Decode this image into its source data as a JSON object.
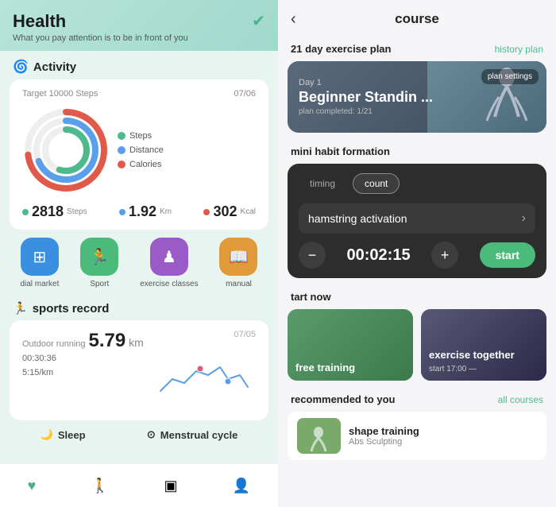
{
  "left": {
    "header": {
      "title": "Health",
      "subtitle": "What you pay attention is to be in front of you",
      "icon": "✔"
    },
    "activity": {
      "section_label": "Activity",
      "target": "Target 10000 Steps",
      "date": "07/06",
      "legend": [
        {
          "label": "Steps",
          "color": "#4cba8e"
        },
        {
          "label": "Distance",
          "color": "#5a9fea"
        },
        {
          "label": "Calories",
          "color": "#e05a4a"
        }
      ],
      "stats": [
        {
          "value": "2818",
          "unit": "Steps",
          "color": "#4cba8e"
        },
        {
          "value": "1.92",
          "unit": "Km",
          "color": "#5a9fea"
        },
        {
          "value": "302",
          "unit": "Kcal",
          "color": "#e05a4a"
        }
      ]
    },
    "quick_actions": [
      {
        "label": "dial market",
        "bg": "#3a8fe0",
        "icon": "⊞"
      },
      {
        "label": "Sport",
        "bg": "#4cba7a",
        "icon": "🏃"
      },
      {
        "label": "exercise classes",
        "bg": "#9a5ac8",
        "icon": "♟"
      },
      {
        "label": "manual",
        "bg": "#e09a3a",
        "icon": "📖"
      }
    ],
    "sports_record": {
      "section_label": "sports record",
      "type": "Outdoor running",
      "distance": "5.79",
      "distance_unit": "km",
      "time": "00:30:36",
      "pace": "5:15/km",
      "date": "07/05"
    },
    "bottom_sections": [
      {
        "label": "Sleep",
        "icon": "🌙"
      },
      {
        "label": "Menstrual cycle",
        "icon": "⊙"
      }
    ],
    "bottom_nav": [
      {
        "icon": "♥",
        "active": true
      },
      {
        "icon": "🚶"
      },
      {
        "icon": "▣"
      },
      {
        "icon": "👤"
      }
    ]
  },
  "right": {
    "header": {
      "back": "‹",
      "title": "course"
    },
    "exercise_plan": {
      "title": "21 day exercise plan",
      "link": "history plan",
      "card": {
        "day": "Day 1",
        "name": "Beginner Standin ...",
        "progress": "plan completed: 1/21",
        "settings_btn": "plan settings"
      }
    },
    "mini_habit": {
      "section_label": "mini habit formation",
      "tabs": [
        {
          "label": "timing",
          "active": false
        },
        {
          "label": "count",
          "active": true
        }
      ],
      "exercise": "hamstring activation",
      "timer": "00:02:15",
      "start_btn": "start"
    },
    "start_now": {
      "section_label": "tart now",
      "cards": [
        {
          "label": "free training",
          "bg": "green"
        },
        {
          "label": "exercise together",
          "sub": "start 17:00 —",
          "bg": "dark"
        }
      ]
    },
    "recommended": {
      "section_label": "recommended to you",
      "link": "all courses",
      "items": [
        {
          "name": "shape training",
          "sub": "Abs Sculpting"
        }
      ]
    }
  }
}
